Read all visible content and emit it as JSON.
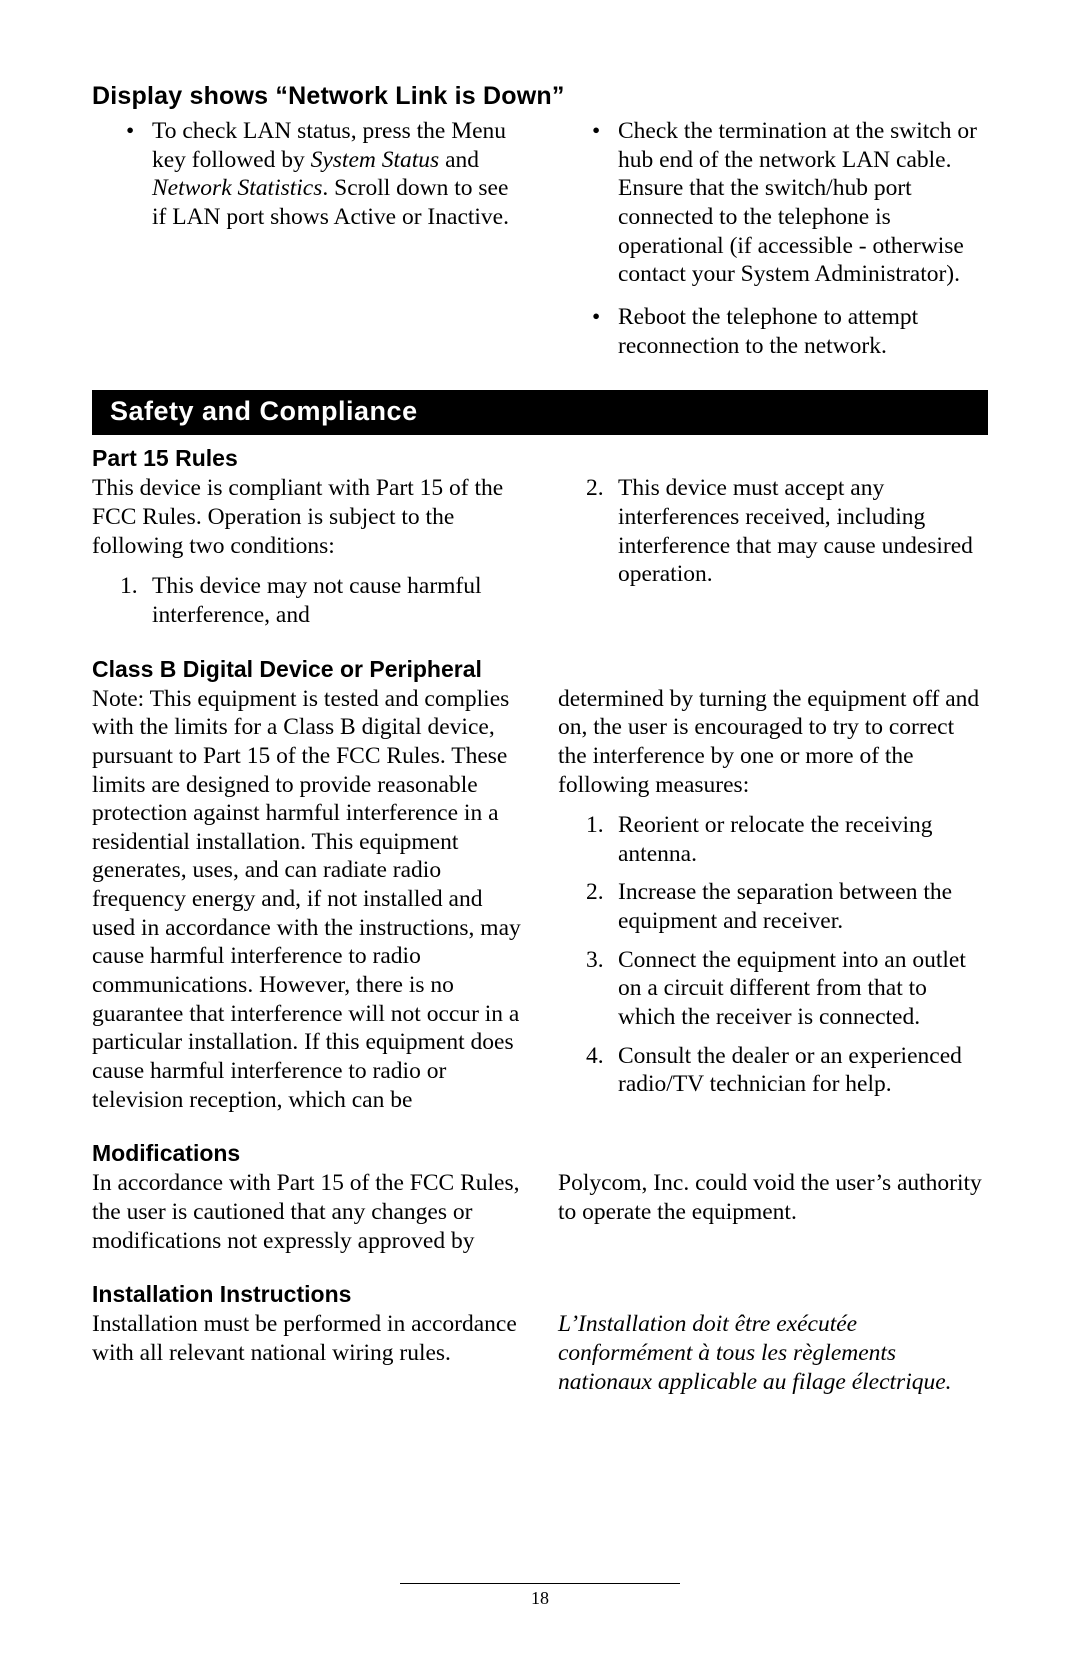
{
  "sec1": {
    "heading": "Display shows “Network Link is Down”",
    "bullets": [
      {
        "pre": "To check LAN status, press the Menu key followed by ",
        "i1": "System Status",
        "mid": " and ",
        "i2": "Network Statistics",
        "post": ".  Scroll down to see if LAN port shows Active or Inactive."
      },
      {
        "text": "Check the termination at the switch or hub end of the network LAN cable.  Ensure that the switch/hub port connected to the telephone is operational (if accessible - otherwise contact your System Administrator)."
      },
      {
        "text": "Reboot the telephone to attempt reconnection to the network."
      }
    ]
  },
  "bar": "Safety and Compliance",
  "sec2": {
    "heading": "Part 15 Rules",
    "intro": "This device is compliant with Part 15 of the FCC Rules.  Operation is subject to the following two conditions:",
    "items": [
      "This device may not cause harmful interference, and",
      "This device must accept any interferences received, including interference that may cause undesired operation."
    ]
  },
  "sec3": {
    "heading": "Class B Digital Device or Peripheral",
    "intro": "Note:  This equipment is tested and complies with the limits for a Class B digital device, pursuant to Part 15 of the FCC Rules.  These limits are designed to provide reasonable protection against harmful interference in a residential installation.  This equipment generates, uses, and can radiate radio frequency energy and, if not installed and used in accordance with the instructions, may cause harmful interference to radio communications.  However, there is no guarantee that interference will not occur in a particular installation.  If this equipment does cause harmful interference to radio or television reception, which can be determined by turning the equipment off and on, the user is encouraged to try to correct the interference by one or more of the following measures:",
    "items": [
      "Reorient or relocate the receiving antenna.",
      "Increase the separation between the equipment and receiver.",
      "Connect the equipment into an outlet on a circuit different from that to which the receiver is connected.",
      "Consult the dealer or an experienced radio/TV technician for help."
    ]
  },
  "sec4": {
    "heading": "Modifications",
    "text": "In accordance with Part 15 of the FCC Rules, the user is cautioned that any changes or modifications not expressly approved by Polycom, Inc. could void the user’s authority to operate the equipment."
  },
  "sec5": {
    "heading": "Installation Instructions",
    "en": "Installation must be performed in accordance with all relevant national wiring rules.",
    "fr": "L’Installation doit être exécutée conformément à tous les règlements nationaux applicable au filage électrique."
  },
  "footer": {
    "page": "18"
  }
}
